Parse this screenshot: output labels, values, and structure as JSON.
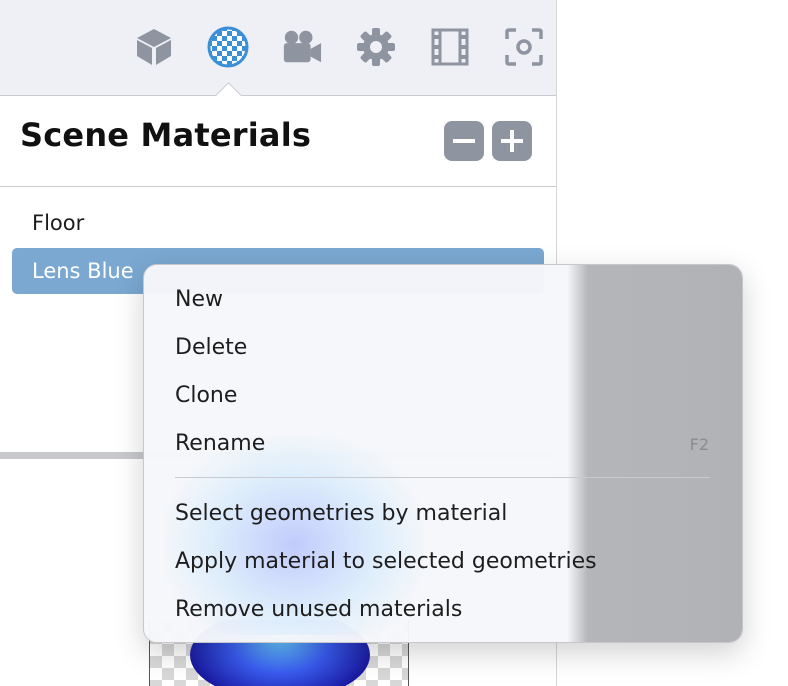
{
  "toolbar": {
    "icons": [
      {
        "name": "objects",
        "icon": "cube-icon",
        "active": false
      },
      {
        "name": "materials",
        "icon": "checker-sphere-icon",
        "active": true
      },
      {
        "name": "camera",
        "icon": "video-camera-icon",
        "active": false
      },
      {
        "name": "settings",
        "icon": "gear-icon",
        "active": false
      },
      {
        "name": "animation",
        "icon": "film-strip-icon",
        "active": false
      },
      {
        "name": "render",
        "icon": "focus-frame-icon",
        "active": false
      }
    ],
    "icon_color": "#8e94a0",
    "active_color": "#3b8fd6"
  },
  "header": {
    "title": "Scene Materials",
    "remove_button_icon": "minus-icon",
    "add_button_icon": "plus-icon"
  },
  "materials": [
    {
      "label": "Floor",
      "selected": false
    },
    {
      "label": "Lens Blue",
      "selected": true
    }
  ],
  "context_menu": {
    "items": [
      {
        "label": "New",
        "shortcut": ""
      },
      {
        "label": "Delete",
        "shortcut": ""
      },
      {
        "label": "Clone",
        "shortcut": ""
      },
      {
        "label": "Rename",
        "shortcut": "F2"
      },
      {
        "label": "Select geometries by material",
        "shortcut": ""
      },
      {
        "label": "Apply material to selected geometries",
        "shortcut": ""
      },
      {
        "label": "Remove unused materials",
        "shortcut": ""
      }
    ]
  },
  "colors": {
    "selection": "#7aa8d1",
    "toolbar_bg": "#eef0f5"
  }
}
